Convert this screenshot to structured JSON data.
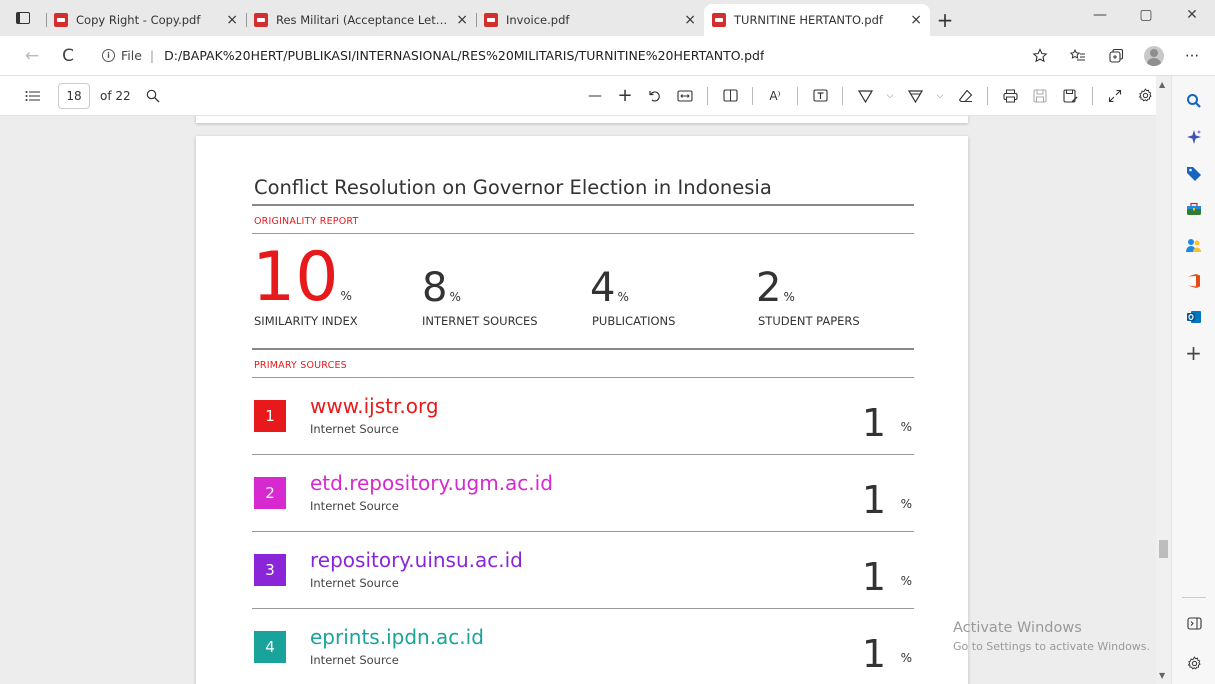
{
  "tabs": [
    {
      "title": "Copy Right - Copy.pdf",
      "close": "×"
    },
    {
      "title": "Res Militari (Acceptance Letters)...",
      "close": "×"
    },
    {
      "title": "Invoice.pdf",
      "close": "×"
    },
    {
      "title": "TURNITINE HERTANTO.pdf",
      "close": "×"
    }
  ],
  "window": {
    "new_tab": "+",
    "minimize": "—",
    "restore": "▢",
    "close": "✕"
  },
  "address": {
    "back": "←",
    "refresh": "C",
    "info": "i",
    "file_label": "File",
    "separator": "|",
    "url": "D:/BAPAK%20HERT/PUBLIKASI/INTERNASIONAL/RES%20MILITARIS/TURNITINE%20HERTANTO.pdf",
    "more": "···"
  },
  "pdf_toolbar": {
    "page_current": "18",
    "page_total": "of 22",
    "zoom_out": "—",
    "zoom_in": "+",
    "read_aloud": "A⁾",
    "chevron": "⌵"
  },
  "document": {
    "title": "Conflict Resolution on Governor Election in Indonesia",
    "originality_label": "ORIGINALITY REPORT",
    "primary_label": "PRIMARY SOURCES",
    "stats": [
      {
        "value": "10",
        "pct": "%",
        "label": "SIMILARITY INDEX"
      },
      {
        "value": "8",
        "pct": "%",
        "label": "INTERNET SOURCES"
      },
      {
        "value": "4",
        "pct": "%",
        "label": "PUBLICATIONS"
      },
      {
        "value": "2",
        "pct": "%",
        "label": "STUDENT PAPERS"
      }
    ],
    "sources": [
      {
        "rank": "1",
        "name": "www.ijstr.org",
        "type": "Internet Source",
        "pct": "1",
        "pct_sign": "%",
        "color": "#e8191b"
      },
      {
        "rank": "2",
        "name": "etd.repository.ugm.ac.id",
        "type": "Internet Source",
        "pct": "1",
        "pct_sign": "%",
        "color": "#d62ad0"
      },
      {
        "rank": "3",
        "name": "repository.uinsu.ac.id",
        "type": "Internet Source",
        "pct": "1",
        "pct_sign": "%",
        "color": "#8a26d8"
      },
      {
        "rank": "4",
        "name": "eprints.ipdn.ac.id",
        "type": "Internet Source",
        "pct": "1",
        "pct_sign": "%",
        "color": "#1aa39a"
      }
    ]
  },
  "watermark": {
    "title": "Activate Windows",
    "subtitle": "Go to Settings to activate Windows."
  },
  "sidebar": {
    "add": "+"
  }
}
